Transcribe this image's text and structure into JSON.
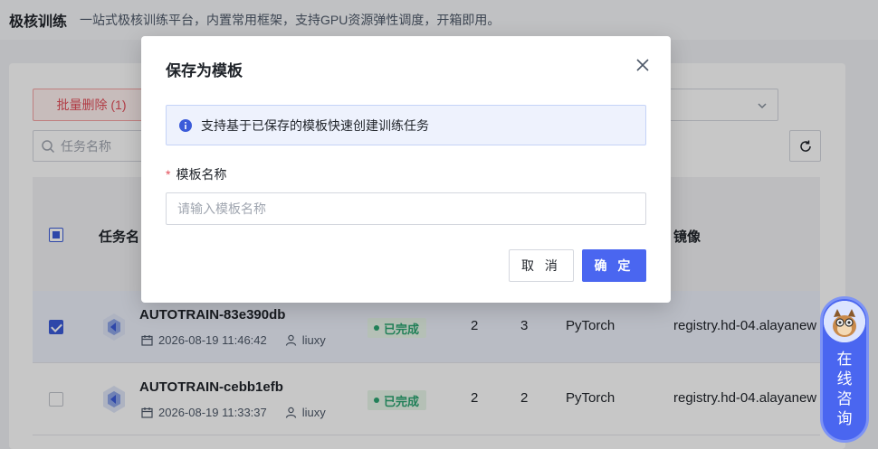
{
  "header": {
    "title": "极核训练",
    "description": "一站式极核训练平台，内置常用框架，支持GPU资源弹性调度，开箱即用。"
  },
  "toolbar": {
    "batch_delete_label": "批量删除 (1)",
    "search_placeholder": "任务名称"
  },
  "table": {
    "columns": [
      "任务名",
      "镜像"
    ],
    "rows": [
      {
        "name": "AUTOTRAIN-83e390db",
        "created": "2026-08-19 11:46:42",
        "user": "liuxy",
        "status": "已完成",
        "col_a": "2",
        "col_b": "3",
        "framework": "PyTorch",
        "image": "registry.hd-04.alayanew",
        "selected": true
      },
      {
        "name": "AUTOTRAIN-cebb1efb",
        "created": "2026-08-19 11:33:37",
        "user": "liuxy",
        "status": "已完成",
        "col_a": "2",
        "col_b": "2",
        "framework": "PyTorch",
        "image": "registry.hd-04.alayanew",
        "selected": false
      }
    ]
  },
  "dialog": {
    "title": "保存为模板",
    "info": "支持基于已保存的模板快速创建训练任务",
    "field_label": "模板名称",
    "required_mark": "*",
    "input_placeholder": "请输入模板名称",
    "input_value": "",
    "cancel_label": "取 消",
    "ok_label": "确 定"
  },
  "consult": {
    "label": "在线咨询"
  },
  "colors": {
    "primary": "#4a66f0",
    "danger": "#e34d59",
    "success": "#2ba471"
  },
  "icons": [
    "search-icon",
    "refresh-icon",
    "close-icon",
    "info-icon",
    "calendar-icon",
    "user-icon",
    "task-icon",
    "chevron-down-icon"
  ]
}
